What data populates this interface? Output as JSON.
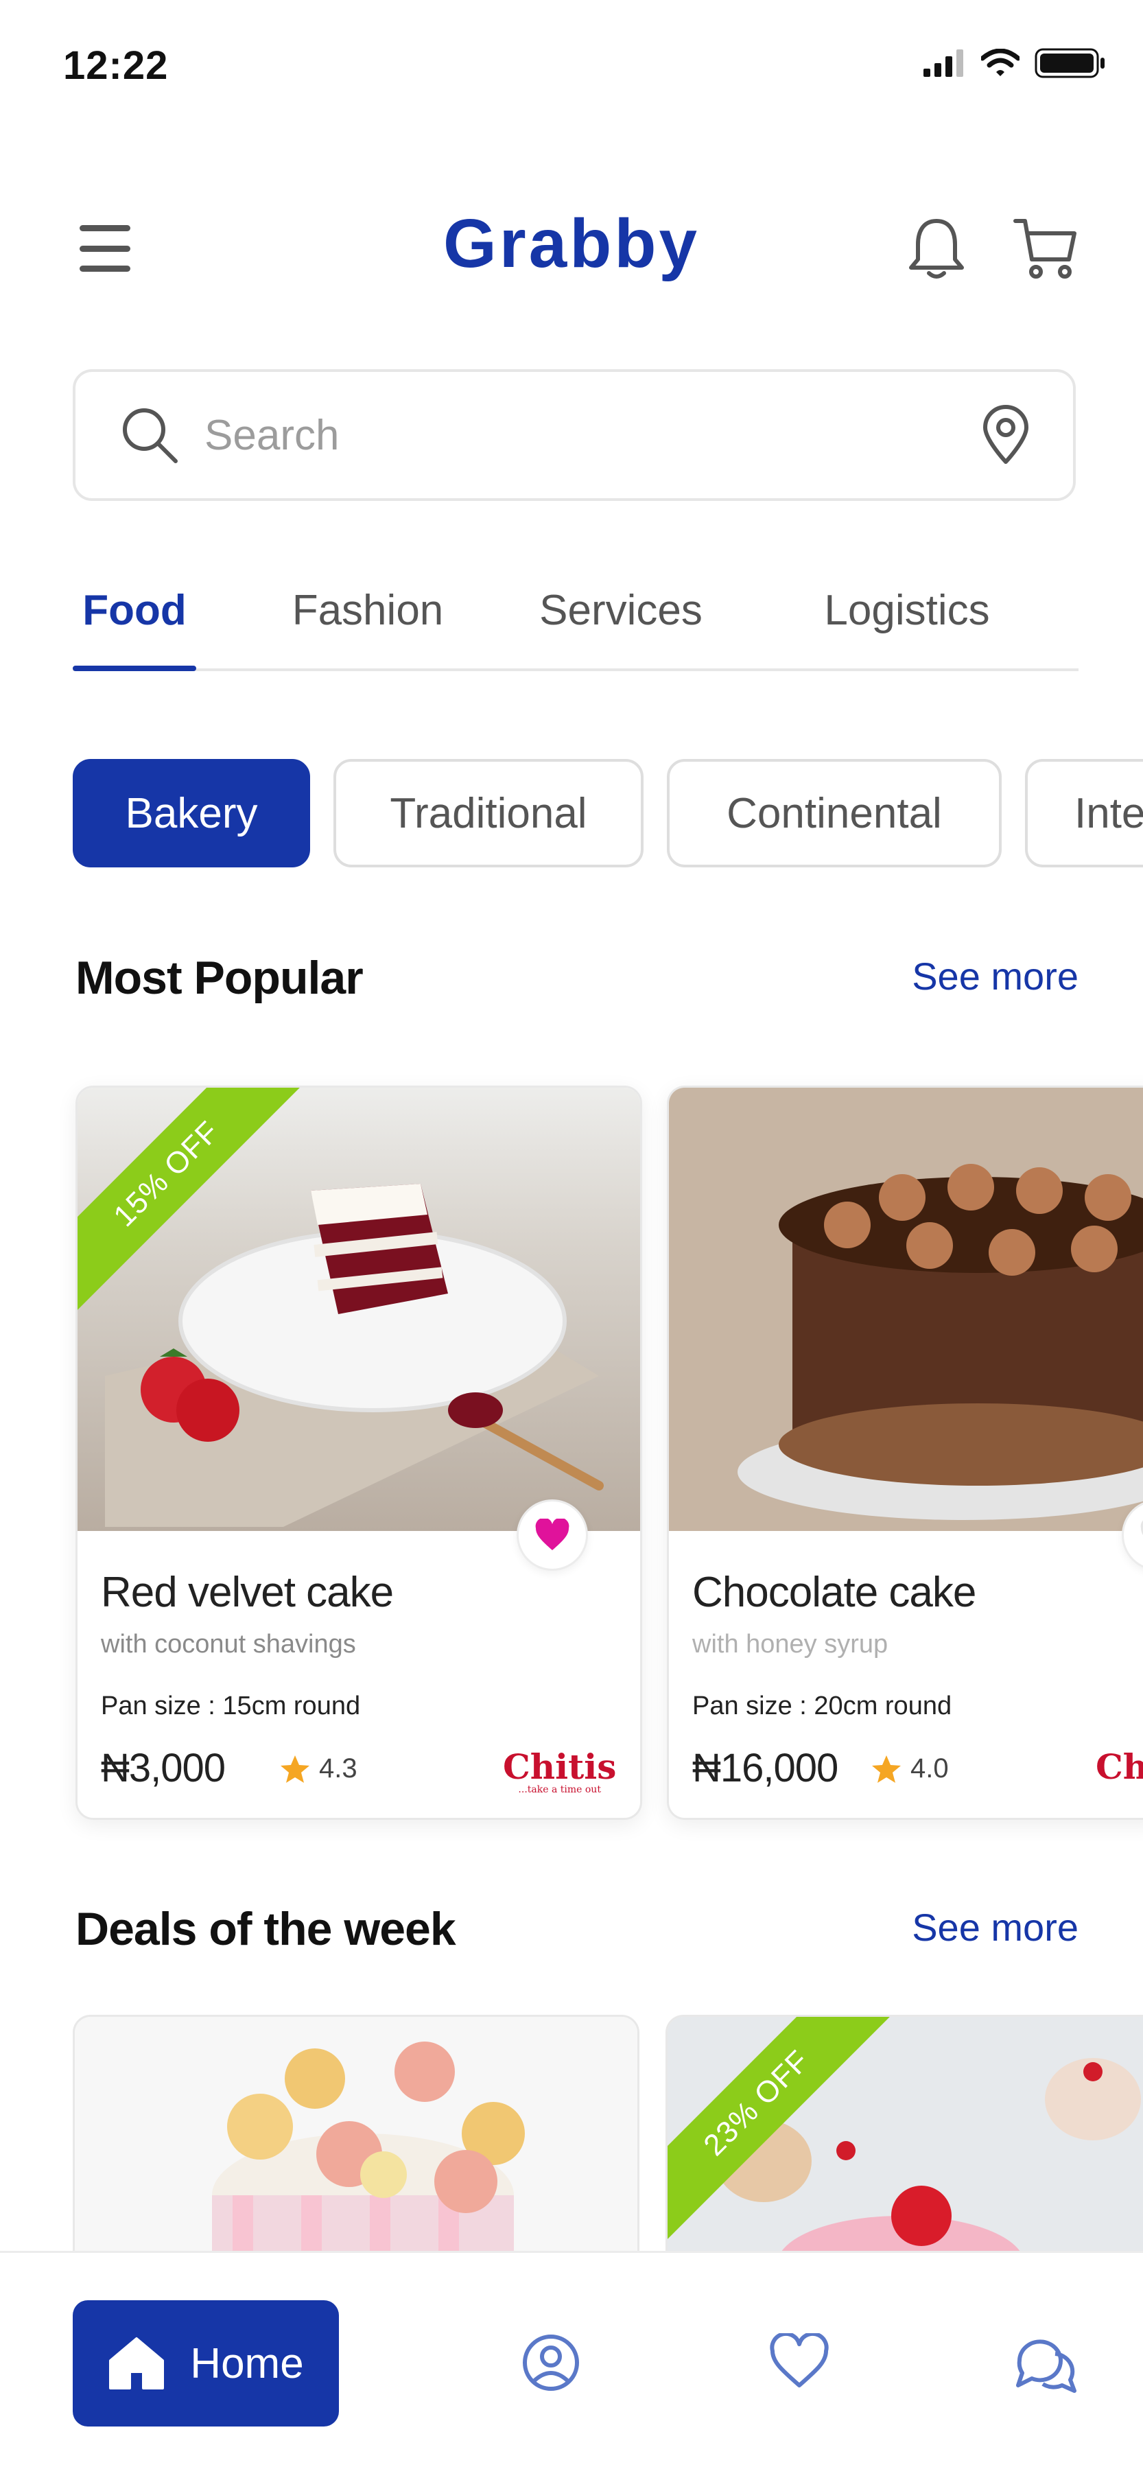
{
  "status_bar": {
    "time": "12:22"
  },
  "header": {
    "title": "Grabby"
  },
  "search": {
    "placeholder": "Search"
  },
  "tabs": [
    "Food",
    "Fashion",
    "Services",
    "Logistics"
  ],
  "chips": [
    "Bakery",
    "Traditional",
    "Continental",
    "Inte"
  ],
  "most_popular": {
    "title": "Most Popular",
    "see_more": "See more",
    "items": [
      {
        "badge": "15% OFF",
        "name": "Red velvet cake",
        "subtitle": "with coconut shavings",
        "pan": "Pan size : 15cm round",
        "price": "₦3,000",
        "rating": "4.3",
        "vendor": "Chitis",
        "vendor_tagline": "...take a time out"
      },
      {
        "badge": "",
        "name": "Chocolate cake",
        "subtitle": "with honey syrup",
        "pan": "Pan size : 20cm round",
        "price": "₦16,000",
        "rating": "4.0",
        "vendor": "Chi"
      }
    ]
  },
  "deals": {
    "title": "Deals of the week",
    "see_more": "See more",
    "items": [
      {
        "badge": ""
      },
      {
        "badge": "23% OFF"
      }
    ]
  },
  "bottom_nav": {
    "home_label": "Home"
  },
  "colors": {
    "primary": "#1636a7",
    "ribbon": "#8ccc1a",
    "favorite": "#e0129b",
    "star": "#f5a623"
  }
}
